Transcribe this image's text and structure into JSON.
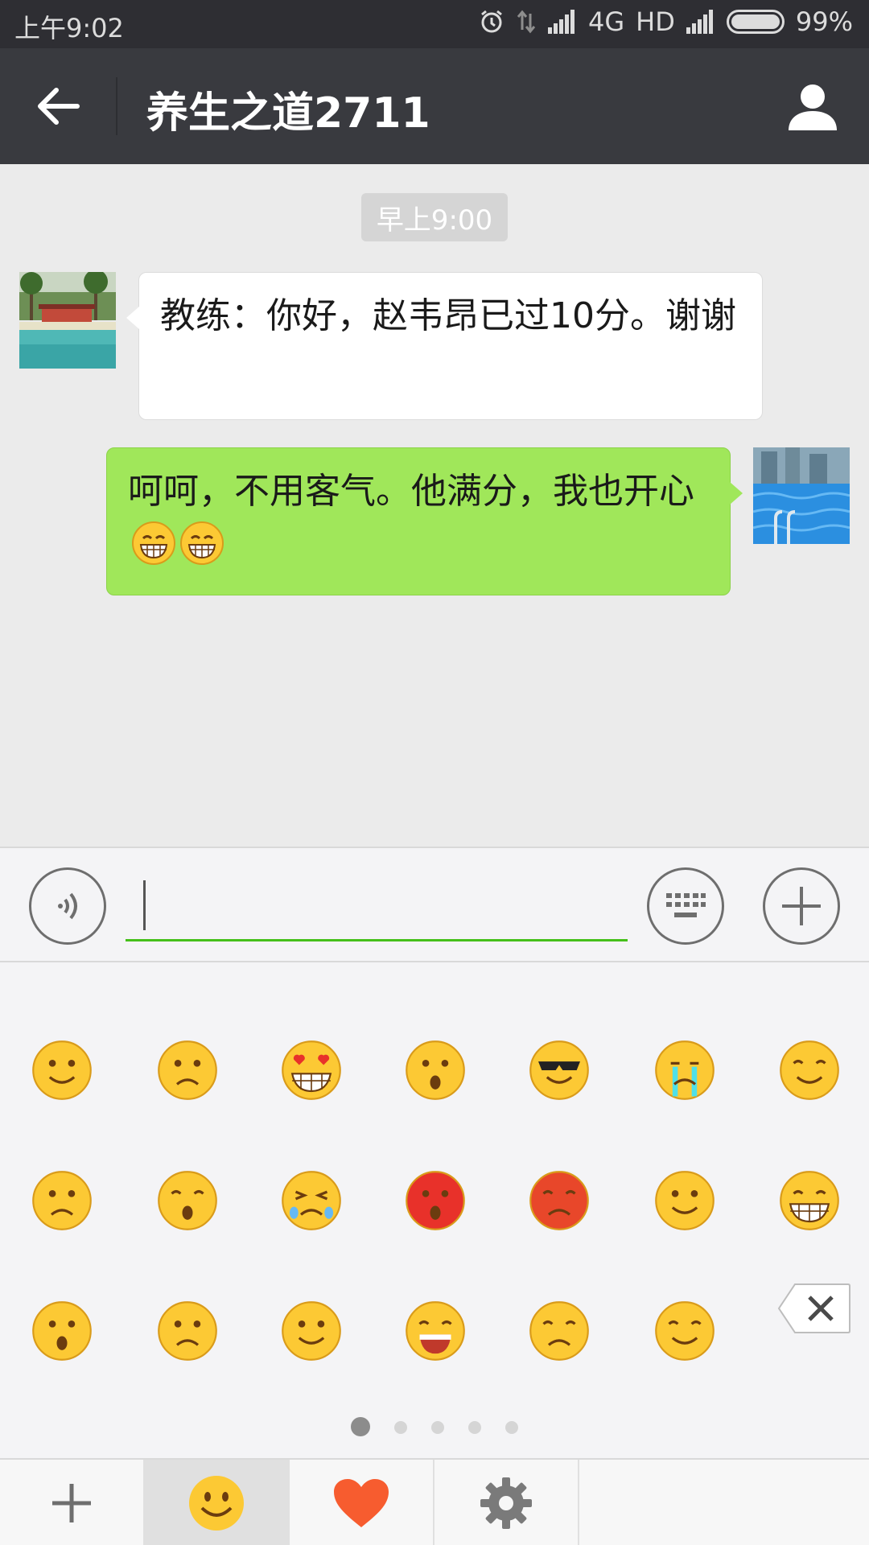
{
  "status_bar": {
    "time": "上午9:02",
    "network": "4G",
    "hd_label": "HD",
    "battery": "99%"
  },
  "header": {
    "title": "养生之道2711",
    "icons": [
      "back-arrow-icon",
      "profile-icon"
    ]
  },
  "chat": {
    "timestamp": "早上9:00",
    "messages": [
      {
        "direction": "incoming",
        "text": "教练：你好，赵韦昂已过10分。谢谢",
        "emoji": []
      },
      {
        "direction": "outgoing",
        "text": "呵呵，不用客气。他满分，我也开心",
        "emoji": [
          "grin-emoji",
          "grin-emoji"
        ]
      }
    ]
  },
  "input_bar": {
    "value": "",
    "placeholder": "",
    "icons": [
      "voice-icon",
      "keyboard-icon",
      "plus-icon"
    ],
    "accent_color": "#45c01a"
  },
  "emoji_panel": {
    "rows": [
      [
        "smile",
        "awkward",
        "heart-eyes",
        "shocked",
        "cool",
        "crying",
        "shy"
      ],
      [
        "shut-mouth",
        "sleep",
        "sob",
        "embarrassed",
        "angry",
        "tongue",
        "grin"
      ],
      [
        "surprised",
        "frown",
        "blush",
        "scream",
        "vomit",
        "chuckle"
      ]
    ],
    "delete_icon": "backspace-icon",
    "pages": 5,
    "current_page": 1
  },
  "bottom_toolbar": {
    "tabs": [
      "add-icon",
      "emoji-icon",
      "heart-icon",
      "settings-icon"
    ],
    "selected": 1
  },
  "colors": {
    "status_bar_bg": "#2e2e33",
    "title_bar_bg": "#393a3f",
    "outgoing_bubble": "#a0e75a",
    "incoming_bubble": "#ffffff",
    "chat_bg": "#ebebeb",
    "heart": "#f75c2f"
  }
}
